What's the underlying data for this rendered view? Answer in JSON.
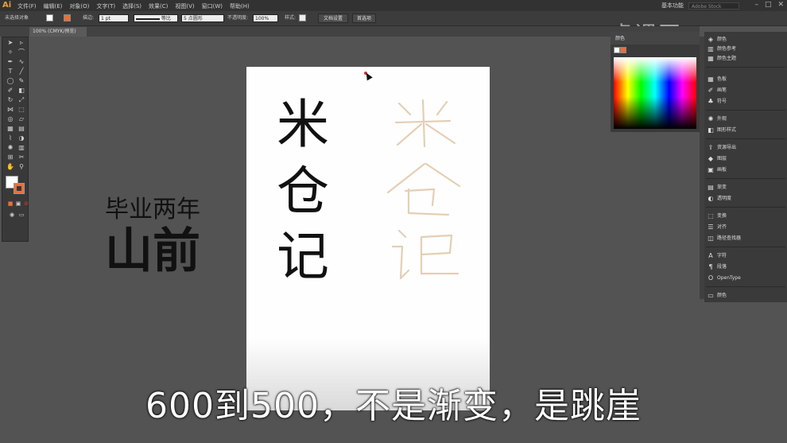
{
  "app": {
    "logo": "Ai",
    "workspace": "基本功能",
    "stock_placeholder": "Adobe Stock"
  },
  "menu": [
    "文件(F)",
    "编辑(E)",
    "对象(O)",
    "文字(T)",
    "选择(S)",
    "效果(C)",
    "视图(V)",
    "窗口(W)",
    "帮助(H)"
  ],
  "control": {
    "no_selection": "未选择对象",
    "stroke_label": "描边:",
    "stroke_weight": "1 pt",
    "stroke_style": "等比",
    "brush": "5 点圆形",
    "opacity_label": "不透明度:",
    "opacity_value": "100%",
    "style_label": "样式:",
    "doc_setup": "文档设置",
    "preferences": "首选项"
  },
  "doc_tab": "100% (CMYK/预览)",
  "watermark": "虎课网",
  "artboard": {
    "chars": [
      "米",
      "仓",
      "记"
    ]
  },
  "canvas_text": {
    "line1": "毕业两年",
    "line2": "山前"
  },
  "subtitle": "600到500，不是渐变，是跳崖",
  "panels": [
    {
      "icon": "grid-icon",
      "label": "色板"
    },
    {
      "icon": "brush-icon",
      "label": "画笔"
    },
    {
      "icon": "club-icon",
      "label": "符号"
    },
    {
      "icon": "sun-icon",
      "label": "外观"
    },
    {
      "icon": "style-icon",
      "label": "图形样式"
    },
    {
      "icon": "export-icon",
      "label": "资源导出"
    },
    {
      "icon": "layers-icon",
      "label": "图层"
    },
    {
      "icon": "artboard-icon",
      "label": "画板"
    },
    {
      "icon": "gradient-icon",
      "label": "渐变"
    },
    {
      "icon": "transparency-icon",
      "label": "透明度"
    },
    {
      "icon": "transform-icon",
      "label": "变换"
    },
    {
      "icon": "align-icon",
      "label": "对齐"
    },
    {
      "icon": "pathfinder-icon",
      "label": "路径查找器"
    },
    {
      "icon": "char-icon",
      "label": "字符"
    },
    {
      "icon": "para-icon",
      "label": "段落"
    },
    {
      "icon": "opentype-icon",
      "label": "OpenType"
    },
    {
      "icon": "link-icon",
      "label": "颜色"
    }
  ],
  "top_panels": [
    {
      "icon": "color-icon",
      "label": "颜色"
    },
    {
      "icon": "guide-icon",
      "label": "颜色参考"
    },
    {
      "icon": "theme-icon",
      "label": "颜色主题"
    }
  ],
  "colors": {
    "accent": "#e8703a",
    "canvas": "#535353",
    "panel": "#3a3a3a"
  }
}
